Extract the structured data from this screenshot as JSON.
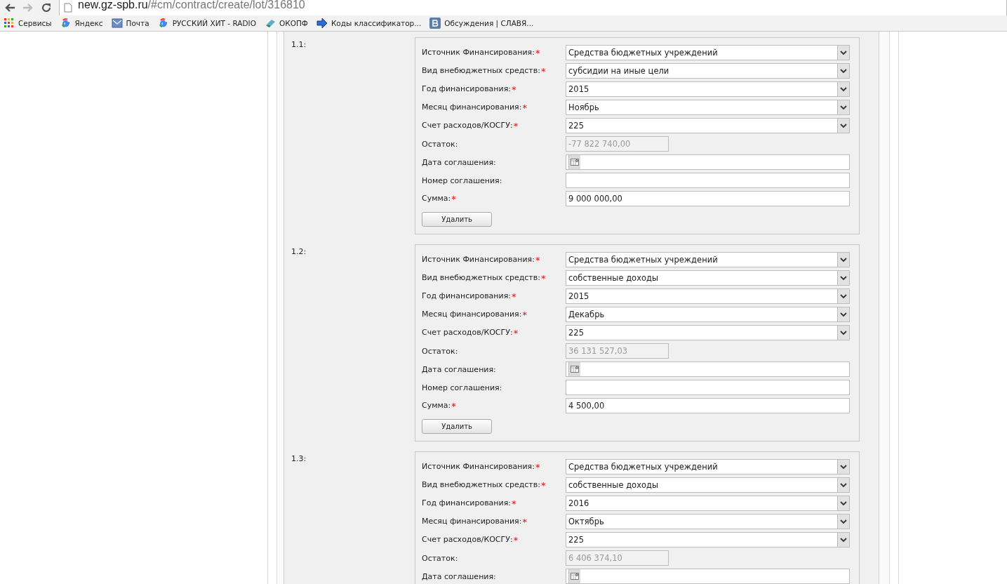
{
  "toolbar": {
    "url_host": "new.gz-spb.ru",
    "url_path": "/#cm/contract/create/lot/316810"
  },
  "bookmarks": [
    {
      "kind": "apps",
      "label": "Сервисы"
    },
    {
      "kind": "google",
      "label": "Яндекс"
    },
    {
      "kind": "mail",
      "label": "Почта"
    },
    {
      "kind": "google",
      "label": "РУССКИЙ ХИТ - RADIO"
    },
    {
      "kind": "okopf",
      "label": "ОКОПФ"
    },
    {
      "kind": "arrow",
      "label": "Коды классификатор..."
    },
    {
      "kind": "vk",
      "label": "Обсуждения | СЛАВЯ..."
    }
  ],
  "sources": [
    {
      "number": "1.1:",
      "fields": [
        {
          "label": "Источник Финансирования:",
          "required_mark": "*",
          "kind": "select",
          "value": "Средства бюджетных учреждений"
        },
        {
          "label": "Вид внебюджетных средств:",
          "required_mark": "*",
          "kind": "select",
          "value": "субсидии на иные цели"
        },
        {
          "label": "Год финансирования:",
          "required_mark": "*",
          "kind": "select",
          "value": "2015"
        },
        {
          "label": "Месяц финансирования:",
          "required_mark": "*",
          "kind": "select",
          "value": "Ноябрь"
        },
        {
          "label": "Счет расходов/КОСГУ:",
          "required_mark": "*",
          "kind": "select",
          "value": "225"
        },
        {
          "label": "Остаток:",
          "kind": "readonly",
          "value": "-77 822 740,00"
        },
        {
          "label": "Дата соглашения:",
          "kind": "date"
        },
        {
          "label": "Номер соглашения:",
          "kind": "text"
        },
        {
          "label": "Сумма:",
          "required_mark": "*",
          "kind": "text",
          "value": "9 000 000,00"
        }
      ],
      "button": "Удалить"
    },
    {
      "number": "1.2:",
      "fields": [
        {
          "label": "Источник Финансирования:",
          "required_mark": "*",
          "kind": "select",
          "value": "Средства бюджетных учреждений"
        },
        {
          "label": "Вид внебюджетных средств:",
          "required_mark": "*",
          "kind": "select",
          "value": "собственные доходы"
        },
        {
          "label": "Год финансирования:",
          "required_mark": "*",
          "kind": "select",
          "value": "2015"
        },
        {
          "label": "Месяц финансирования:",
          "required_mark": "*",
          "kind": "select",
          "value": "Декабрь"
        },
        {
          "label": "Счет расходов/КОСГУ:",
          "required_mark": "*",
          "kind": "select",
          "value": "225"
        },
        {
          "label": "Остаток:",
          "kind": "readonly",
          "value": "36 131 527,03"
        },
        {
          "label": "Дата соглашения:",
          "kind": "date"
        },
        {
          "label": "Номер соглашения:",
          "kind": "text"
        },
        {
          "label": "Сумма:",
          "required_mark": "*",
          "kind": "text",
          "value": "4 500,00"
        }
      ],
      "button": "Удалить"
    },
    {
      "number": "1.3:",
      "fields": [
        {
          "label": "Источник Финансирования:",
          "required_mark": "*",
          "kind": "select",
          "value": "Средства бюджетных учреждений"
        },
        {
          "label": "Вид внебюджетных средств:",
          "required_mark": "*",
          "kind": "select",
          "value": "собственные доходы"
        },
        {
          "label": "Год финансирования:",
          "required_mark": "*",
          "kind": "select",
          "value": "2016"
        },
        {
          "label": "Месяц финансирования:",
          "required_mark": "*",
          "kind": "select",
          "value": "Октябрь"
        },
        {
          "label": "Счет расходов/КОСГУ:",
          "required_mark": "*",
          "kind": "select",
          "value": "225"
        },
        {
          "label": "Остаток:",
          "kind": "readonly",
          "value": "6 406 374,10"
        },
        {
          "label": "Дата соглашения:",
          "kind": "date"
        }
      ]
    }
  ]
}
